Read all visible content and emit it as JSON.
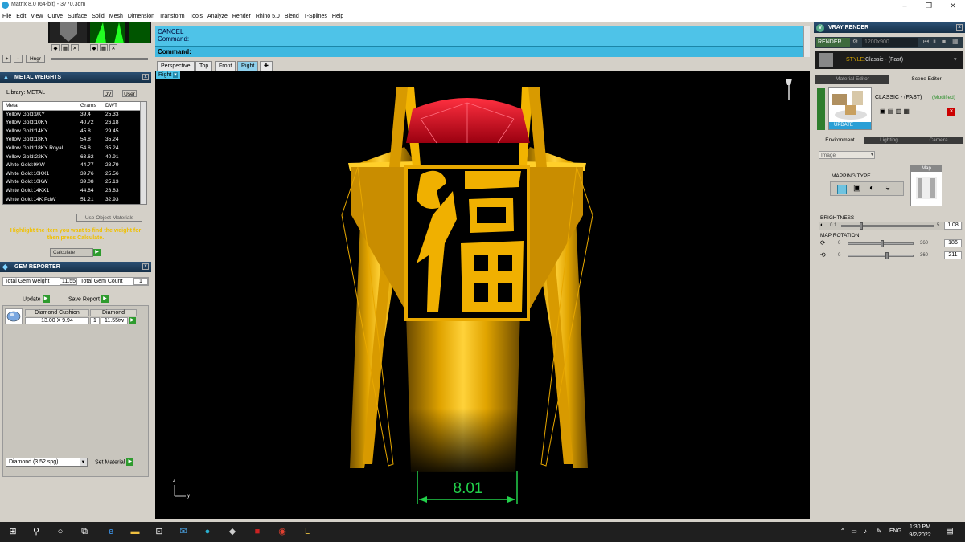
{
  "window": {
    "title": "Matrix 8.0 (64-bit) - 3770.3dm",
    "minimize": "–",
    "maximize": "❐",
    "close": "✕"
  },
  "menu": [
    "File",
    "Edit",
    "View",
    "Curve",
    "Surface",
    "Solid",
    "Mesh",
    "Dimension",
    "Transform",
    "Tools",
    "Analyze",
    "Render",
    "Rhino 5.0",
    "Blend",
    "T-Splines",
    "Help"
  ],
  "left_top": {
    "hngr_label": "Hngr"
  },
  "metal_weights": {
    "title": "METAL WEIGHTS",
    "library_label": "Library: METAL",
    "toggle_a": "DV",
    "toggle_b": "User",
    "columns": [
      "Metal",
      "Grams",
      "DWT"
    ],
    "rows": [
      [
        "Yellow Gold:9KY",
        "39.4",
        "25.33"
      ],
      [
        "Yellow Gold:10KY",
        "40.72",
        "26.18"
      ],
      [
        "Yellow Gold:14KY",
        "45.8",
        "29.45"
      ],
      [
        "Yellow Gold:18KY",
        "54.8",
        "35.24"
      ],
      [
        "Yellow Gold:18KY Royal",
        "54.8",
        "35.24"
      ],
      [
        "Yellow Gold:22KY",
        "63.62",
        "40.91"
      ],
      [
        "White Gold:9KW",
        "44.77",
        "28.79"
      ],
      [
        "White Gold:10KX1",
        "39.76",
        "25.56"
      ],
      [
        "White Gold:10KW",
        "39.08",
        "25.13"
      ],
      [
        "White Gold:14KX1",
        "44.84",
        "28.83"
      ],
      [
        "White Gold:14K PdW",
        "51.21",
        "32.93"
      ]
    ],
    "use_object_materials": "Use Object Materials",
    "hint": "Highlight the item you want to find the weight for then press Calculate.",
    "calculate": "Calculate"
  },
  "gem_reporter": {
    "title": "GEM REPORTER",
    "total_weight_label": "Total Gem Weight",
    "total_weight": "11.55",
    "total_count_label": "Total Gem Count",
    "total_count": "1",
    "update": "Update",
    "save_report": "Save Report",
    "gem_shape": "Diamond Cushion",
    "gem_material": "Diamond",
    "gem_size": "13.00 X 9.94",
    "gem_qty": "1",
    "gem_weight": "11.55tw",
    "material_select": "Diamond    (3.52 spg)",
    "set_material": "Set Material"
  },
  "command": {
    "line1": "CANCEL",
    "line2": "Command:",
    "prompt": "Command:"
  },
  "viewport": {
    "tabs": [
      "Perspective",
      "Top",
      "Front",
      "Right"
    ],
    "active_tab": "Right",
    "view_label": "Right",
    "dimension": "8.01",
    "axis_z": "z",
    "axis_y": "y",
    "colors": {
      "gold": "#f2b400",
      "ruby": "#d0001a",
      "dimension": "#22d04a"
    }
  },
  "vray": {
    "title": "VRAY RENDER",
    "render": "RENDER",
    "resolution": "1200x900",
    "style_label": "STYLE:",
    "style_value": "Classic - (Fast)",
    "tab_material": "Material Editor",
    "tab_scene": "Scene Editor",
    "scene_name": "CLASSIC - (FAST)",
    "scene_modified": "(Modified)",
    "update": "UPDATE",
    "subtabs": [
      "Environment",
      "Lighting",
      "Camera"
    ],
    "env_select": "Image",
    "mapping_type": "MAPPING TYPE",
    "map_label": "Map",
    "brightness_label": "BRIGHTNESS",
    "brightness_min": "0.1",
    "brightness_max": "5",
    "brightness_value": "1.08",
    "brightness_frac": 0.2,
    "map_rotation_label": "MAP ROTATION",
    "rot1_min": "0",
    "rot1_max": "360",
    "rot1_value": "186",
    "rot2_min": "0",
    "rot2_max": "360",
    "rot2_value": "211"
  },
  "taskbar": {
    "lang": "ENG",
    "time": "1:30 PM",
    "date": "9/2/2022"
  }
}
